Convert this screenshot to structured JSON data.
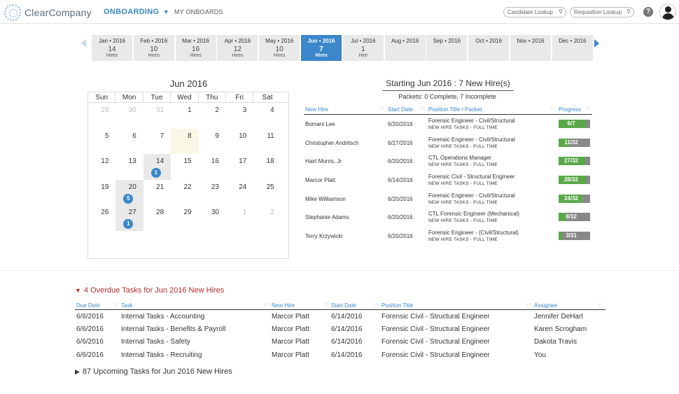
{
  "app": {
    "logo_text": "ClearCompany",
    "nav": {
      "onboarding": "ONBOARDING",
      "onboarding_caret": "▼",
      "my_onboards": "MY ONBOARDS"
    },
    "search": {
      "candidate": "Candidate Lookup",
      "requisition": "Requisition Lookup",
      "icon_glyph": "⚲"
    },
    "help_glyph": "?"
  },
  "months": [
    {
      "name": "Jan • 2016",
      "count": "14",
      "label": "Hires",
      "active": false
    },
    {
      "name": "Feb • 2016",
      "count": "10",
      "label": "Hires",
      "active": false
    },
    {
      "name": "Mar • 2016",
      "count": "16",
      "label": "Hires",
      "active": false
    },
    {
      "name": "Apr • 2016",
      "count": "12",
      "label": "Hires",
      "active": false
    },
    {
      "name": "May • 2016",
      "count": "10",
      "label": "Hires",
      "active": false
    },
    {
      "name": "Jun • 2016",
      "count": "7",
      "label": "Hires",
      "active": true
    },
    {
      "name": "Jul • 2016",
      "count": "1",
      "label": "Hire",
      "active": false
    },
    {
      "name": "Aug • 2016",
      "count": "",
      "label": "",
      "active": false
    },
    {
      "name": "Sep • 2016",
      "count": "",
      "label": "",
      "active": false
    },
    {
      "name": "Oct • 2016",
      "count": "",
      "label": "",
      "active": false
    },
    {
      "name": "Nov • 2016",
      "count": "",
      "label": "",
      "active": false
    },
    {
      "name": "Dec • 2016",
      "count": "",
      "label": "",
      "active": false
    }
  ],
  "calendar": {
    "title": "Jun 2016",
    "weekdays": [
      "Sun",
      "Mon",
      "Tue",
      "Wed",
      "Thu",
      "Fri",
      "Sat"
    ],
    "weeks": [
      [
        {
          "d": "29",
          "m": true
        },
        {
          "d": "30",
          "m": true
        },
        {
          "d": "31",
          "m": true
        },
        {
          "d": "1"
        },
        {
          "d": "2"
        },
        {
          "d": "3"
        },
        {
          "d": "4"
        }
      ],
      [
        {
          "d": "5"
        },
        {
          "d": "6"
        },
        {
          "d": "7"
        },
        {
          "d": "8",
          "today": true
        },
        {
          "d": "9"
        },
        {
          "d": "10"
        },
        {
          "d": "11"
        }
      ],
      [
        {
          "d": "12"
        },
        {
          "d": "13"
        },
        {
          "d": "14",
          "badge": "1"
        },
        {
          "d": "15"
        },
        {
          "d": "16"
        },
        {
          "d": "17"
        },
        {
          "d": "18"
        }
      ],
      [
        {
          "d": "19"
        },
        {
          "d": "20",
          "badge": "5"
        },
        {
          "d": "21"
        },
        {
          "d": "22"
        },
        {
          "d": "23"
        },
        {
          "d": "24"
        },
        {
          "d": "25"
        }
      ],
      [
        {
          "d": "26"
        },
        {
          "d": "27",
          "badge": "1"
        },
        {
          "d": "28"
        },
        {
          "d": "29"
        },
        {
          "d": "30"
        },
        {
          "d": "1",
          "m": true
        },
        {
          "d": "2",
          "m": true
        }
      ]
    ]
  },
  "hires": {
    "title": "Starting Jun 2016 : 7 New Hire(s)",
    "packets": "Packets: 0 Complete, 7 Incomplete",
    "columns": {
      "name": "New Hire",
      "start": "Start Date",
      "position": "Position Title / Packet",
      "progress": "Progress",
      "sort_glyph": "↓↑"
    },
    "rows": [
      {
        "name": "Bomani Lee",
        "start": "6/20/2016",
        "position": "Forensic Engineer - Civil/Structural",
        "packet": "NEW HIRE TASKS - FULL TIME",
        "progress": "6/7",
        "pct": 0.857
      },
      {
        "name": "Christopher Andritsch",
        "start": "6/27/2016",
        "position": "Forensic Engineer - Civil/Structural",
        "packet": "NEW HIRE TASKS - FULL TIME",
        "progress": "11/32",
        "pct": 0.34
      },
      {
        "name": "Hairl Morris, Jr",
        "start": "6/20/2016",
        "position": "CTL Operations Manager",
        "packet": "NEW HIRE TASKS - FULL TIME",
        "progress": "27/32",
        "pct": 0.84
      },
      {
        "name": "Marcor Platt",
        "start": "6/14/2016",
        "position": "Forensic Civil - Structural Engineer",
        "packet": "NEW HIRE TASKS - FULL TIME",
        "progress": "28/32",
        "pct": 0.875
      },
      {
        "name": "Mike Williamson",
        "start": "6/20/2016",
        "position": "Forensic Engineer - Civil/Structural",
        "packet": "NEW HIRE TASKS - FULL TIME",
        "progress": "24/32",
        "pct": 0.75
      },
      {
        "name": "Stephanie Adams",
        "start": "6/20/2016",
        "position": "CTL Forensic Engineer (Mechanical)",
        "packet": "NEW HIRE TASKS - FULL TIME",
        "progress": "8/32",
        "pct": 0.25
      },
      {
        "name": "Terry Krzywicki",
        "start": "6/20/2016",
        "position": "Forensic Engineer - (Civil/Structural)",
        "packet": "NEW HIRE TASKS - FULL TIME",
        "progress": "3/31",
        "pct": 0.1
      }
    ]
  },
  "overdue": {
    "title": "4 Overdue Tasks for Jun 2016 New Hires",
    "toggle_glyph": "▼",
    "columns": {
      "due": "Due Date",
      "task": "Task",
      "hire": "New Hire",
      "start": "Start Date",
      "position": "Position Title",
      "assignee": "Assignee",
      "sort_glyph": "↓↑"
    },
    "rows": [
      {
        "due": "6/6/2016",
        "task": "Internal Tasks - Accounting",
        "hire": "Marcor Platt",
        "start": "6/14/2016",
        "position": "Forensic Civil - Structural Engineer",
        "assignee": "Jennifer DeHart"
      },
      {
        "due": "6/6/2016",
        "task": "Internal Tasks - Benefits & Payroll",
        "hire": "Marcor Platt",
        "start": "6/14/2016",
        "position": "Forensic Civil - Structural Engineer",
        "assignee": "Karen Scrogham"
      },
      {
        "due": "6/6/2016",
        "task": "Internal Tasks - Safety",
        "hire": "Marcor Platt",
        "start": "6/14/2016",
        "position": "Forensic Civil - Structural Engineer",
        "assignee": "Dakota Travis"
      },
      {
        "due": "6/6/2016",
        "task": "Internal Tasks - Recruiting",
        "hire": "Marcor Platt",
        "start": "6/14/2016",
        "position": "Forensic Civil - Structural Engineer",
        "assignee": "You"
      }
    ]
  },
  "upcoming": {
    "title": "87 Upcoming Tasks for Jun 2016 New Hires",
    "toggle_glyph": "▶"
  }
}
